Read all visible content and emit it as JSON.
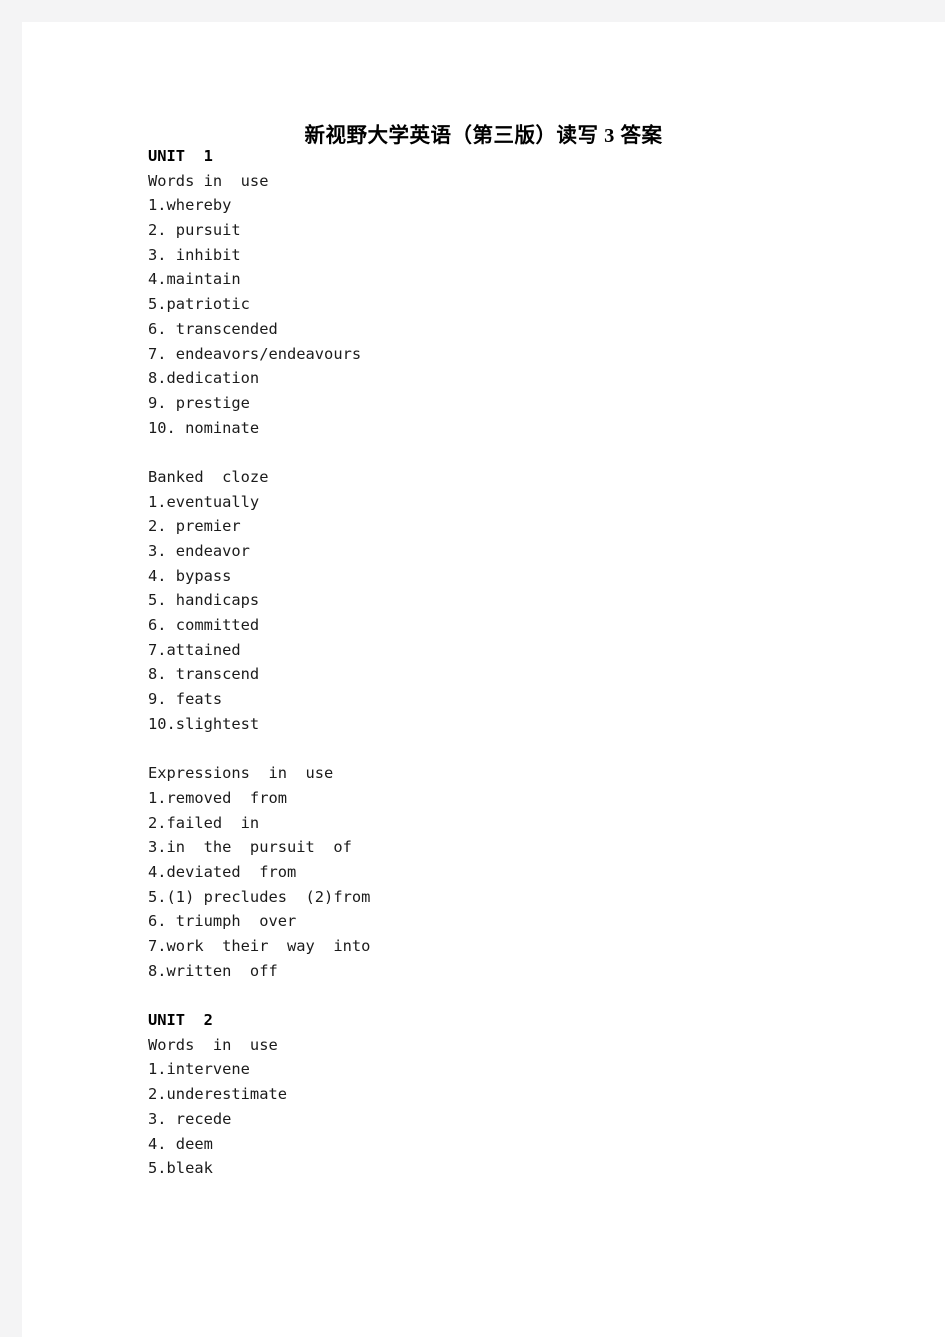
{
  "document": {
    "title": "新视野大学英语（第三版）读写 3 答案",
    "lines": [
      {
        "kind": "unit-heading",
        "text": "UNIT  1"
      },
      {
        "kind": "section-heading",
        "text": "Words in  use"
      },
      {
        "kind": "answer",
        "text": "1.whereby"
      },
      {
        "kind": "answer",
        "text": "2. pursuit"
      },
      {
        "kind": "answer",
        "text": "3. inhibit"
      },
      {
        "kind": "answer",
        "text": "4.maintain"
      },
      {
        "kind": "answer",
        "text": "5.patriotic"
      },
      {
        "kind": "answer",
        "text": "6. transcended"
      },
      {
        "kind": "answer",
        "text": "7. endeavors/endeavours"
      },
      {
        "kind": "answer",
        "text": "8.dedication"
      },
      {
        "kind": "answer",
        "text": "9. prestige"
      },
      {
        "kind": "answer",
        "text": "10. nominate"
      },
      {
        "kind": "spacer",
        "text": ""
      },
      {
        "kind": "section-heading",
        "text": "Banked  cloze"
      },
      {
        "kind": "answer",
        "text": "1.eventually"
      },
      {
        "kind": "answer",
        "text": "2. premier"
      },
      {
        "kind": "answer",
        "text": "3. endeavor"
      },
      {
        "kind": "answer",
        "text": "4. bypass"
      },
      {
        "kind": "answer",
        "text": "5. handicaps"
      },
      {
        "kind": "answer",
        "text": "6. committed"
      },
      {
        "kind": "answer",
        "text": "7.attained"
      },
      {
        "kind": "answer",
        "text": "8. transcend"
      },
      {
        "kind": "answer",
        "text": "9. feats"
      },
      {
        "kind": "answer",
        "text": "10.slightest"
      },
      {
        "kind": "spacer",
        "text": ""
      },
      {
        "kind": "section-heading",
        "text": "Expressions  in  use"
      },
      {
        "kind": "answer",
        "text": "1.removed  from"
      },
      {
        "kind": "answer",
        "text": "2.failed  in"
      },
      {
        "kind": "answer",
        "text": "3.in  the  pursuit  of"
      },
      {
        "kind": "answer",
        "text": "4.deviated  from"
      },
      {
        "kind": "answer",
        "text": "5.(1) precludes  (2)from"
      },
      {
        "kind": "answer",
        "text": "6. triumph  over"
      },
      {
        "kind": "answer",
        "text": "7.work  their  way  into"
      },
      {
        "kind": "answer",
        "text": "8.written  off"
      },
      {
        "kind": "spacer",
        "text": ""
      },
      {
        "kind": "unit-heading",
        "text": "UNIT  2"
      },
      {
        "kind": "section-heading",
        "text": "Words  in  use"
      },
      {
        "kind": "answer",
        "text": "1.intervene"
      },
      {
        "kind": "answer",
        "text": "2.underestimate"
      },
      {
        "kind": "answer",
        "text": "3. recede"
      },
      {
        "kind": "answer",
        "text": "4. deem"
      },
      {
        "kind": "answer",
        "text": "5.bleak"
      }
    ]
  },
  "colors": {
    "page_background": "#ffffff",
    "gutter_background": "#f4f4f5",
    "body_text": "#1b1b1b",
    "heading_text": "#000000"
  }
}
